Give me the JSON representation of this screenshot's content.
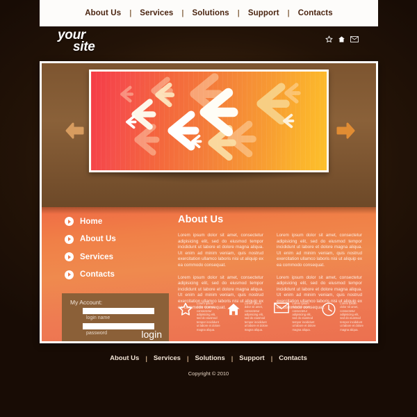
{
  "colors": {
    "page_background": "#190d06",
    "nav_bar": "#fdfcfa",
    "nav_text": "#4a2410",
    "panel_brown": "#8a6139",
    "content_orange": "#ef7a4b",
    "login_box_brown": "#8b6038",
    "banner_gradient_start": "#f53b46",
    "banner_gradient_end": "#fdc02b",
    "arrow_tan": "#d79c5f"
  },
  "topnav": {
    "items": [
      {
        "label": "About Us"
      },
      {
        "label": "Services"
      },
      {
        "label": "Solutions"
      },
      {
        "label": "Support"
      },
      {
        "label": "Contacts"
      }
    ],
    "separator": "|"
  },
  "header": {
    "logo_line1": "your",
    "logo_line2": "site",
    "icons": [
      {
        "name": "star-icon"
      },
      {
        "name": "home-icon"
      },
      {
        "name": "envelope-icon"
      }
    ]
  },
  "slider": {
    "prev_icon": "arrow-left-icon",
    "next_icon": "arrow-right-icon"
  },
  "sidebar": {
    "items": [
      {
        "label": "Home"
      },
      {
        "label": "About Us"
      },
      {
        "label": "Services"
      },
      {
        "label": "Contacts"
      }
    ]
  },
  "login": {
    "title": "My Account:",
    "username_value": "",
    "username_caption": "login name",
    "password_value": "",
    "password_caption": "password",
    "button_label": "login"
  },
  "about": {
    "heading": "About Us",
    "columns": [
      {
        "paragraphs": [
          "Lorem ipsum dolor sit amet, consectetur adipisicing elit, sed do eiusmod tempor incididunt ut labore et dolore magna aliqua. Ut enim ad minim veniam, quis nostrud exercitation ullamco laboris nisi ut aliquip ex ea commodo consequat.",
          "Lorem ipsum dolor sit amet, consectetur adipisicing elit, sed do eiusmod tempor incididunt ut labore et dolore magna aliqua. Ut enim ad minim veniam, quis nostrud exercitation ullamco laboris nisi ut aliquip ex ea commodo consequat."
        ]
      },
      {
        "paragraphs": [
          "Lorem ipsum dolor sit amet, consectetur adipisicing elit, sed do eiusmod tempor incididunt ut labore et dolore magna aliqua. Ut enim ad minim veniam, quis nostrud exercitation ullamco laboris nisi ut aliquip ex ea commodo consequat.",
          "Lorem ipsum dolor sit amet, consectetur adipisicing elit, sed do eiusmod tempor incididunt ut labore et dolore magna aliqua. Ut enim ad minim veniam, quis nostrud exercitation ullamco laboris nisi ut aliquip ex ea commodo consequat."
        ]
      }
    ]
  },
  "features": [
    {
      "icon": "star-icon",
      "text": "Lorem ipsum dolor sit amet, consectetur adipisicing elit, sed do eiusmod tempor incididunt ut labore et dolore magna aliqua."
    },
    {
      "icon": "home-icon",
      "text": "Lorem ipsum dolor sit amet, consectetur adipisicing elit, sed do eiusmod tempor incididunt ut labore et dolore magna aliqua."
    },
    {
      "icon": "envelope-icon",
      "text": "Lorem ipsum dolor sit amet, consectetur adipisicing elit, sed do eiusmod tempor incididunt ut labore et dolore magna aliqua."
    },
    {
      "icon": "clock-icon",
      "text": "Lorem ipsum dolor sit amet, consectetur adipisicing elit, sed do eiusmod tempor incididunt ut labore et dolore magna aliqua."
    }
  ],
  "footer": {
    "items": [
      {
        "label": "About Us"
      },
      {
        "label": "Services"
      },
      {
        "label": "Solutions"
      },
      {
        "label": "Support"
      },
      {
        "label": "Contacts"
      }
    ],
    "separator": "|",
    "copyright": "Copyright © 2010"
  }
}
